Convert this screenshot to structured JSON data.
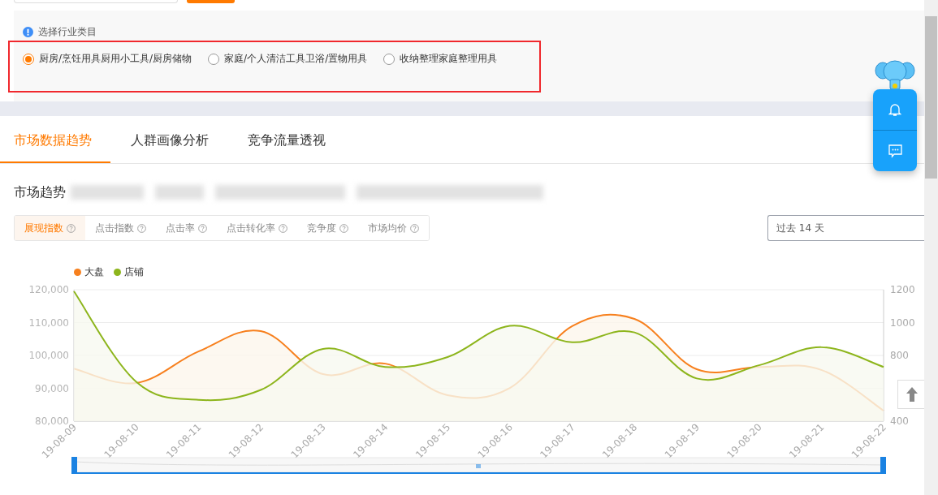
{
  "industry_filter": {
    "title": "选择行业类目",
    "options": [
      {
        "label": "厨房/烹饪用具厨用小工具/厨房储物",
        "selected": true
      },
      {
        "label": "家庭/个人清洁工具卫浴/置物用具",
        "selected": false
      },
      {
        "label": "收纳整理家庭整理用具",
        "selected": false
      }
    ]
  },
  "tabs": [
    {
      "label": "市场数据趋势",
      "selected": true
    },
    {
      "label": "人群画像分析",
      "selected": false
    },
    {
      "label": "竞争流量透视",
      "selected": false
    }
  ],
  "section_title": "市场趋势",
  "metrics": [
    {
      "label": "展现指数",
      "selected": true
    },
    {
      "label": "点击指数",
      "selected": false
    },
    {
      "label": "点击率",
      "selected": false
    },
    {
      "label": "点击转化率",
      "selected": false
    },
    {
      "label": "竞争度",
      "selected": false
    },
    {
      "label": "市场均价",
      "selected": false
    }
  ],
  "period_select": {
    "value": "过去 14 天"
  },
  "charts": [
    {
      "chart_data": {
        "type": "area",
        "categories": [
          "19-08-09",
          "19-08-10",
          "19-08-11",
          "19-08-12",
          "19-08-13",
          "19-08-14",
          "19-08-15",
          "19-08-16",
          "19-08-17",
          "19-08-18",
          "19-08-19",
          "19-08-20",
          "19-08-21",
          "19-08-22"
        ],
        "series": [
          {
            "name": "大盘",
            "color": "#f7801e",
            "values": [
              96000,
              91600,
              101200,
              107400,
              94300,
              97500,
              87900,
              90100,
              108900,
              111100,
              95800,
              96500,
              95600,
              83200
            ]
          }
        ],
        "ylim": [
          80000,
          120000
        ],
        "yticks": [
          {
            "value": 80000,
            "label": "80,000"
          },
          {
            "value": 90000,
            "label": "90,000"
          },
          {
            "value": 100000,
            "label": "100,000"
          },
          {
            "value": 110000,
            "label": "110,000"
          },
          {
            "value": 120000,
            "label": "120,000"
          }
        ]
      }
    },
    {
      "chart_data": {
        "type": "area",
        "series": [
          {
            "name": "店铺",
            "color": "#8db51c",
            "values": [
              1190,
              640,
              530,
              590,
              840,
              730,
              790,
              980,
              880,
              940,
              660,
              740,
              850,
              730
            ]
          }
        ],
        "ylim": [
          400,
          1200
        ],
        "yticks": [
          {
            "value": 400,
            "label": "400"
          },
          {
            "value": 800,
            "label": "800"
          },
          {
            "value": 1000,
            "label": "1000"
          },
          {
            "value": 1200,
            "label": "1200"
          }
        ]
      }
    }
  ]
}
